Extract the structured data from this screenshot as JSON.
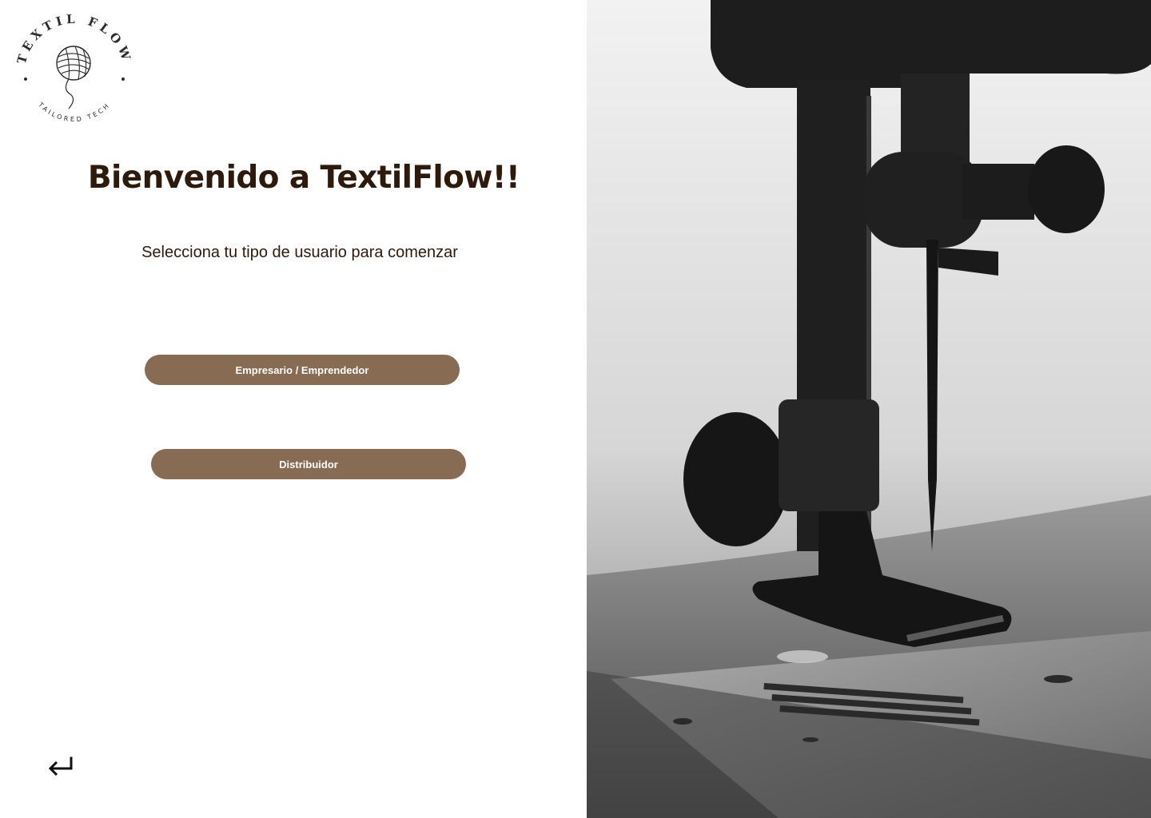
{
  "brand": {
    "logo_top_text": "TEXTIL FLOW",
    "logo_bottom_text": "TAILORED TECH",
    "logo_icon": "yarn-ball-icon"
  },
  "main": {
    "title": "Bienvenido a TextilFlow!!",
    "subtitle": "Selecciona tu tipo de usuario para comenzar"
  },
  "roles": [
    {
      "label": "Empresario / Emprendedor"
    },
    {
      "label": "Distribuidor"
    }
  ],
  "navigation": {
    "back_icon": "return-arrow-icon"
  },
  "hero": {
    "image_icon": "sewing-machine-photo"
  },
  "colors": {
    "accent": "#876b52",
    "text_dark": "#2e1a0b",
    "background": "#ffffff"
  }
}
